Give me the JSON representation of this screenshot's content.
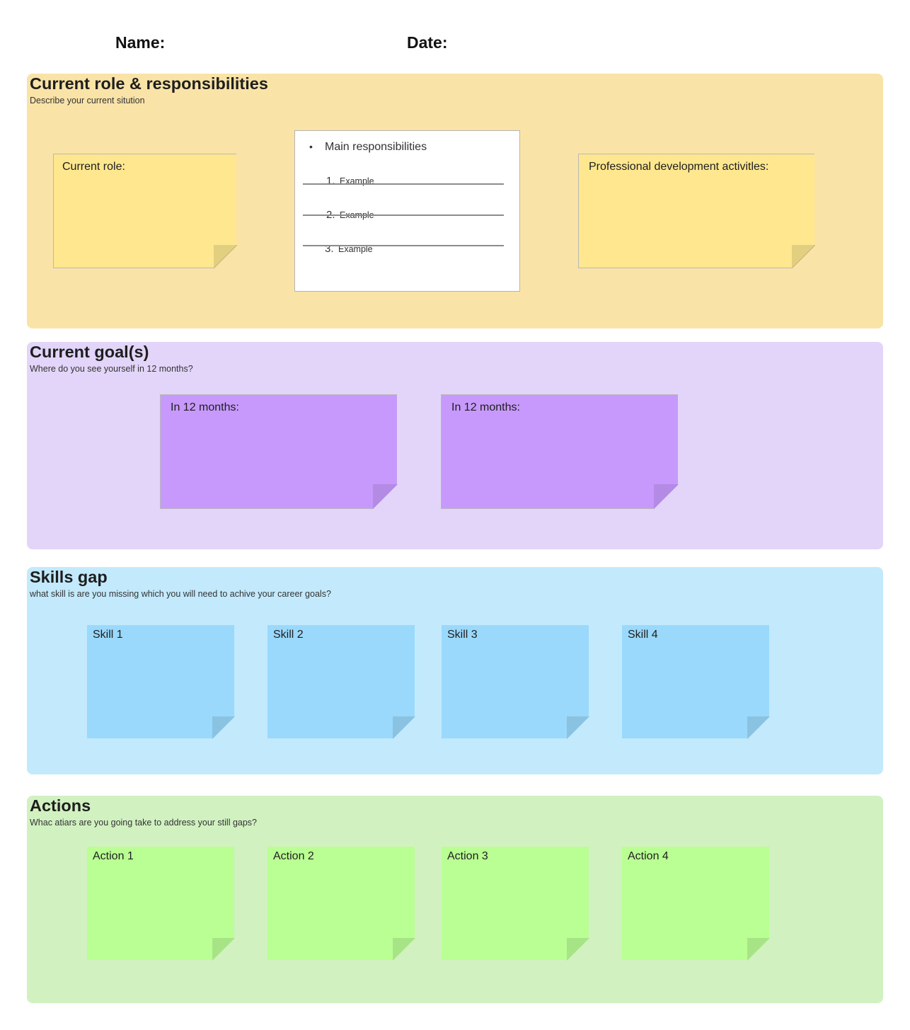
{
  "header": {
    "name_label": "Name:",
    "date_label": "Date:"
  },
  "colors": {
    "role_bg": "#f9e3a7",
    "role_sticky": "#fee78f",
    "role_fold": "#e3cf80",
    "goal_bg": "#e3d4fa",
    "goal_sticky": "#c799fd",
    "goal_fold": "#b38ae4",
    "skills_bg": "#c2eafc",
    "skills_sticky": "#9ad9fc",
    "skills_fold": "#8ac2e2",
    "actions_bg": "#d2f1c1",
    "actions_sticky": "#baff94",
    "actions_fold": "#a7e485"
  },
  "sections": {
    "role": {
      "title": "Current role & responsibilities",
      "subtitle": "Describe your current sitution",
      "current_role_label": "Current role:",
      "responsibilities": {
        "heading": "Main responsibilities",
        "items": [
          {
            "num": "1.",
            "text": "Example"
          },
          {
            "num": "2.",
            "text": "Example"
          },
          {
            "num": "3.",
            "text": "Example"
          }
        ]
      },
      "pd_label": "Professional development activitles:"
    },
    "goals": {
      "title": "Current goal(s)",
      "subtitle": "Where do you see yourself in 12 months?",
      "notes": [
        {
          "label": "In 12 months:"
        },
        {
          "label": "In 12 months:"
        }
      ]
    },
    "skills": {
      "title": "Skills gap",
      "subtitle": "what skill is are you missing which you will need to achive your career goals?",
      "notes": [
        {
          "label": "Skill 1"
        },
        {
          "label": "Skill 2"
        },
        {
          "label": "Skill 3"
        },
        {
          "label": "Skill 4"
        }
      ]
    },
    "actions": {
      "title": "Actions",
      "subtitle": "Whac atiars are you going take to address your still gaps?",
      "notes": [
        {
          "label": "Action 1"
        },
        {
          "label": "Action 2"
        },
        {
          "label": "Action 3"
        },
        {
          "label": "Action 4"
        }
      ]
    }
  }
}
